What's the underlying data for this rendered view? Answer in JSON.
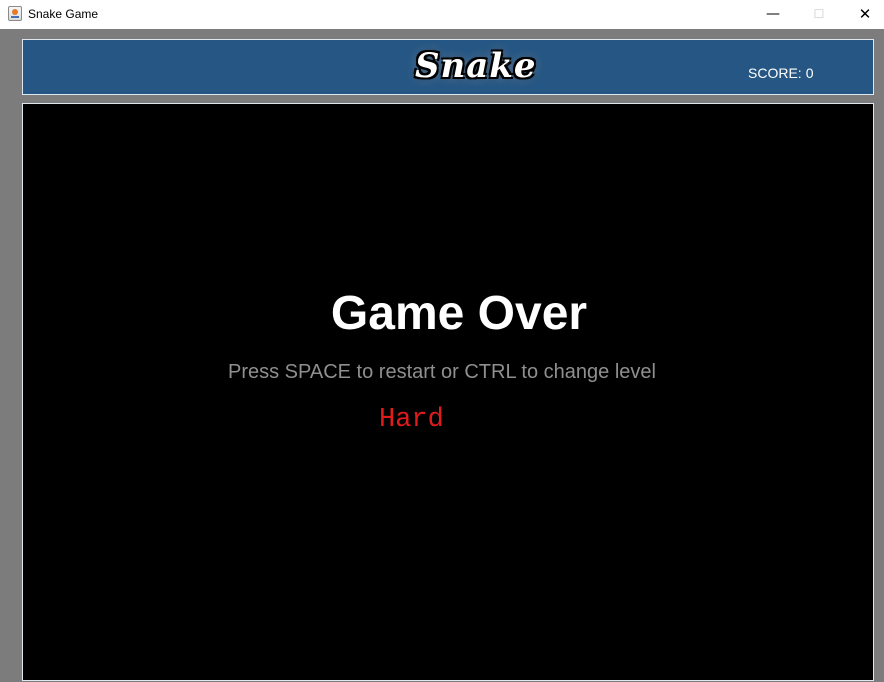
{
  "window": {
    "title": "Snake Game",
    "controls": {
      "minimize": "—",
      "maximize": "☐",
      "close": "✕"
    }
  },
  "header": {
    "logo_text": "Snake",
    "score_label": "SCORE:",
    "score_value": "0"
  },
  "board": {
    "status": "Game Over",
    "hint": "Press SPACE to restart or CTRL to change level",
    "level": "Hard"
  },
  "colors": {
    "header_bg": "#265683",
    "board_bg": "#000000",
    "frame_bg": "#7c7c7c",
    "level_text": "#e01b1b",
    "hint_text": "#8f8f8f"
  },
  "icons": {
    "app": "java-cup-icon"
  }
}
